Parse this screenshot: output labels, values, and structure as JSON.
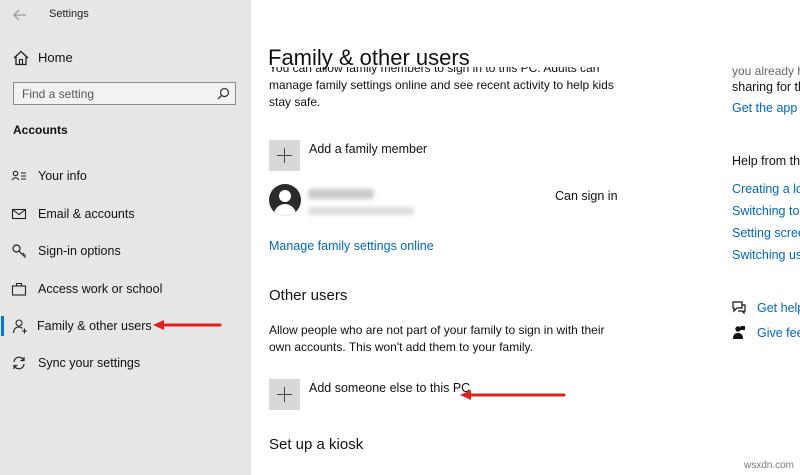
{
  "window": {
    "title": "Settings"
  },
  "sidebar": {
    "home_label": "Home",
    "search_placeholder": "Find a setting",
    "section": "Accounts",
    "items": [
      {
        "label": "Your info",
        "icon": "person-card-icon"
      },
      {
        "label": "Email & accounts",
        "icon": "mail-icon"
      },
      {
        "label": "Sign-in options",
        "icon": "key-icon"
      },
      {
        "label": "Access work or school",
        "icon": "briefcase-icon"
      },
      {
        "label": "Family & other users",
        "icon": "person-add-icon",
        "active": true
      },
      {
        "label": "Sync your settings",
        "icon": "sync-icon"
      }
    ]
  },
  "main": {
    "title": "Family & other users",
    "intro_lines": [
      "You can allow family members to sign in to this PC. Adults can",
      "manage family settings online and see recent activity to help kids",
      "stay safe."
    ],
    "add_family_label": "Add a family member",
    "member_status": "Can sign in",
    "manage_link": "Manage family settings online",
    "other_users_heading": "Other users",
    "other_users_text": "Allow people who are not part of your family to sign in with their own accounts. This won't add them to your family.",
    "add_other_label": "Add someone else to this PC",
    "kiosk_heading": "Set up a kiosk"
  },
  "right_panel": {
    "top_line1": "you already h",
    "top_line2": "sharing for th",
    "get_app_link": "Get the app",
    "help_heading": "Help from the",
    "help_links": [
      "Creating a loc",
      "Switching to a",
      "Setting scree",
      "Switching use"
    ],
    "get_help_link": "Get help",
    "feedback_link": "Give feedb"
  },
  "watermark": "wsxdn.com",
  "colors": {
    "accent": "#0078d7",
    "link": "#0067c0",
    "arrow": "#e0201c",
    "sidebar_bg": "#e6e6e6"
  }
}
